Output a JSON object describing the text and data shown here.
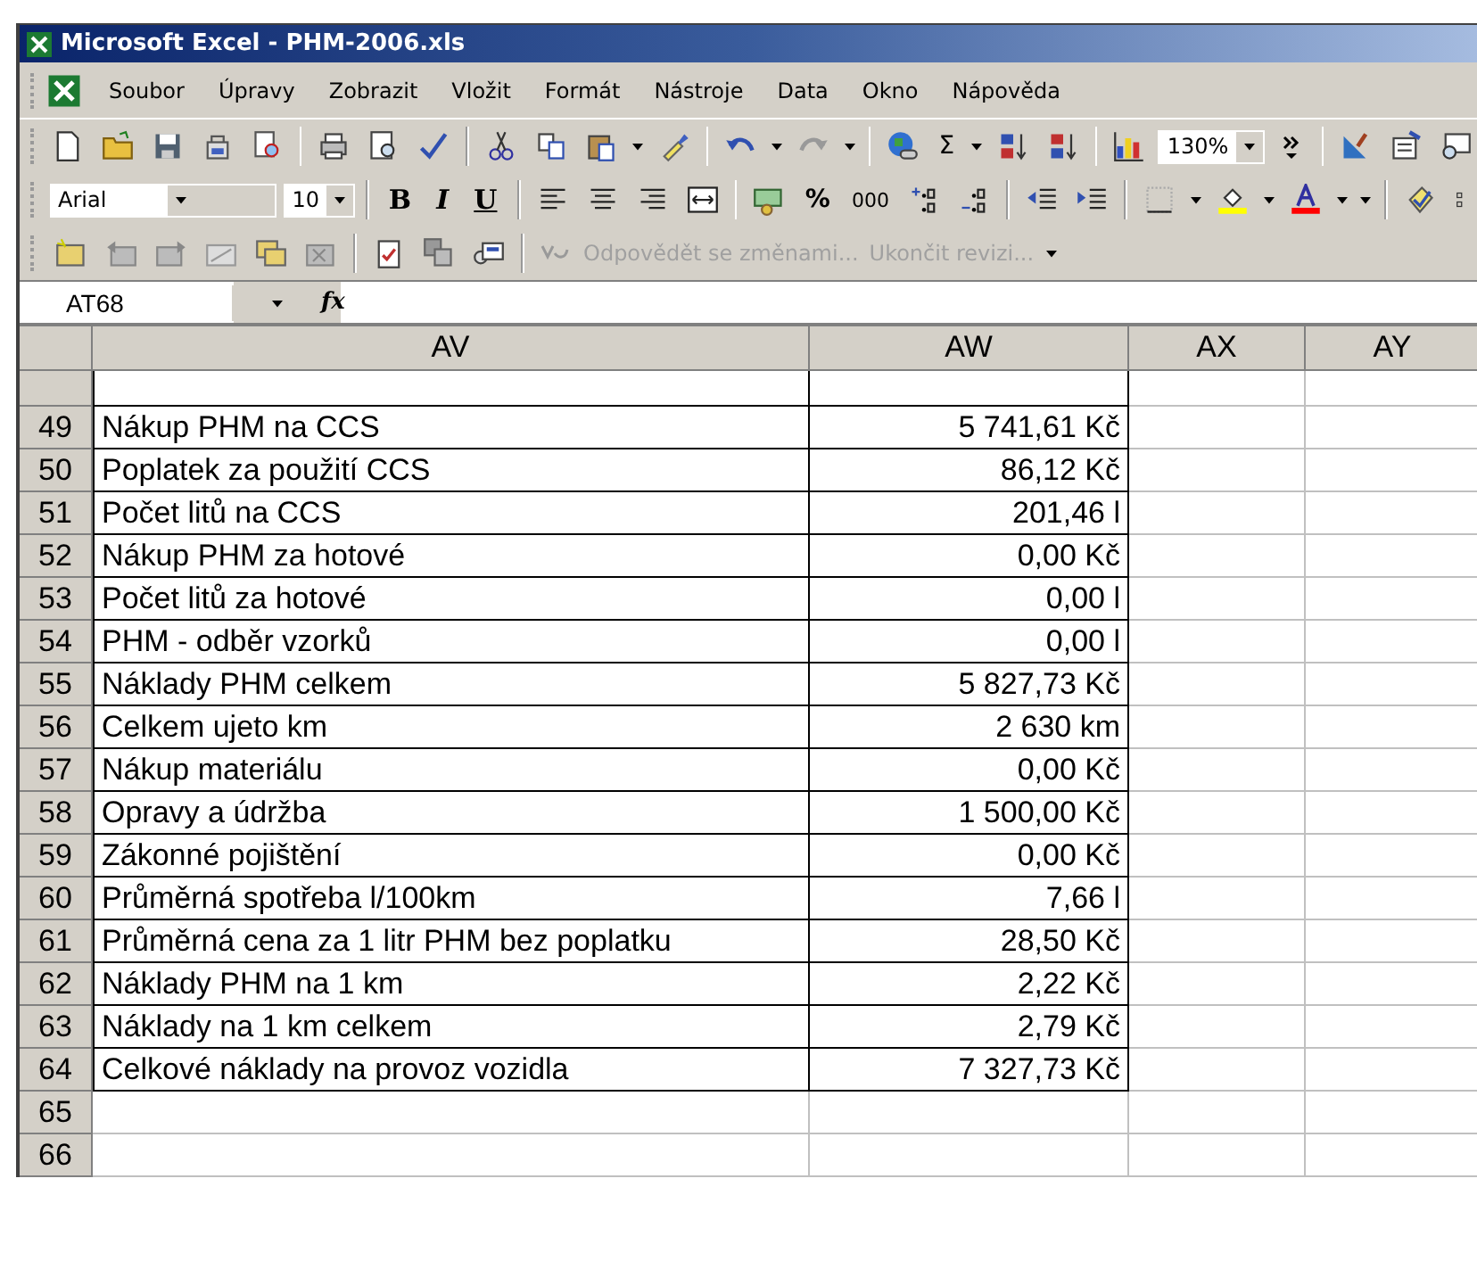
{
  "window": {
    "title": "Microsoft Excel - PHM-2006.xls"
  },
  "menu": [
    "Soubor",
    "Úpravy",
    "Zobrazit",
    "Vložit",
    "Formát",
    "Nástroje",
    "Data",
    "Okno",
    "Nápověda"
  ],
  "standard_toolbar": {
    "sigma": "Σ",
    "zoom": "130%"
  },
  "formatting_toolbar": {
    "font": "Arial",
    "size": "10",
    "bold": "B",
    "italic": "I",
    "underline": "U",
    "percent": "%",
    "thousands": "000"
  },
  "reviewing_toolbar": {
    "items": [
      {
        "label": "Odpovědět se změnami...",
        "disabled": true
      },
      {
        "label": "Ukončit revizi...",
        "disabled": true
      }
    ]
  },
  "formula_bar": {
    "name_box": "AT68",
    "function_label": "fx"
  },
  "sheet": {
    "columns": [
      "AV",
      "AW",
      "AX",
      "AY"
    ],
    "rows": [
      {
        "number": "49",
        "label": "Nákup PHM na CCS",
        "value": "5 741,61 Kč"
      },
      {
        "number": "50",
        "label": "Poplatek za použití CCS",
        "value": "86,12 Kč"
      },
      {
        "number": "51",
        "label": "Počet litů na CCS",
        "value": "201,46 l"
      },
      {
        "number": "52",
        "label": "Nákup PHM za hotové",
        "value": "0,00 Kč"
      },
      {
        "number": "53",
        "label": "Počet litů za hotové",
        "value": "0,00 l"
      },
      {
        "number": "54",
        "label": "PHM - odběr vzorků",
        "value": "0,00 l"
      },
      {
        "number": "55",
        "label": "Náklady PHM celkem",
        "value": "5 827,73 Kč"
      },
      {
        "number": "56",
        "label": "Celkem ujeto km",
        "value": "2 630 km"
      },
      {
        "number": "57",
        "label": "Nákup materiálu",
        "value": "0,00 Kč"
      },
      {
        "number": "58",
        "label": "Opravy a údržba",
        "value": "1 500,00 Kč"
      },
      {
        "number": "59",
        "label": "Zákonné pojištění",
        "value": "0,00 Kč"
      },
      {
        "number": "60",
        "label": "Průměrná spotřeba l/100km",
        "value": "7,66 l"
      },
      {
        "number": "61",
        "label": "Průměrná cena za 1 litr PHM bez poplatku",
        "value": "28,50 Kč"
      },
      {
        "number": "62",
        "label": "Náklady PHM na 1 km",
        "value": "2,22 Kč"
      },
      {
        "number": "63",
        "label": "Náklady na 1 km celkem",
        "value": "2,79 Kč"
      },
      {
        "number": "64",
        "label": "Celkové náklady na provoz vozidla",
        "value": "7 327,73 Kč"
      },
      {
        "number": "65"
      },
      {
        "number": "66"
      }
    ]
  }
}
